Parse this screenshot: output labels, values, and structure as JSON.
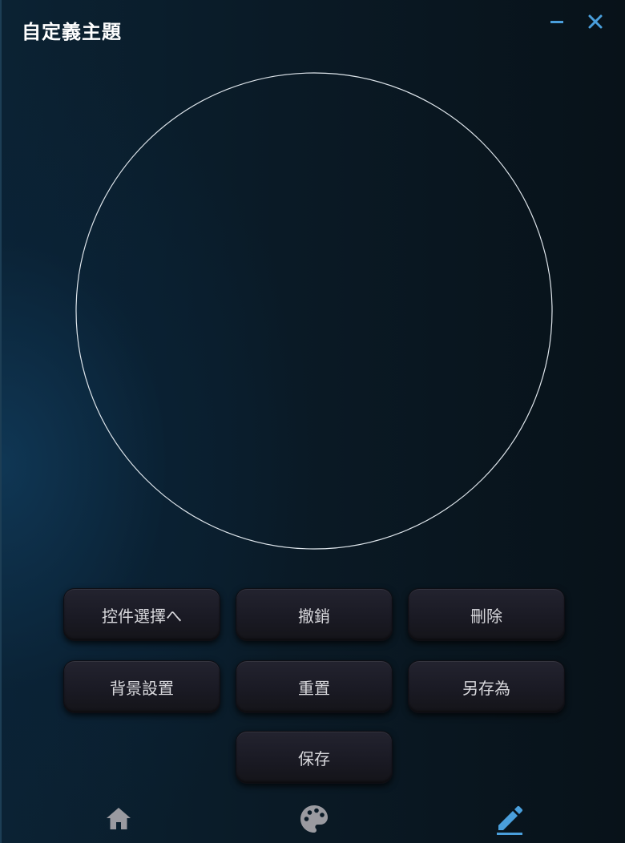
{
  "window": {
    "title": "自定義主題"
  },
  "buttons": {
    "control_select": "控件選擇へ",
    "undo": "撤銷",
    "delete": "刪除",
    "background": "背景設置",
    "reset": "重置",
    "save_as": "另存為",
    "save": "保存"
  },
  "nav": {
    "items": [
      "home-icon",
      "palette-icon",
      "pencil-icon"
    ],
    "active": "pencil-icon"
  },
  "colors": {
    "accent": "#4a9fdc",
    "icon_gray": "#9a9aa0",
    "button_text": "#d8d8dc",
    "circle_stroke": "#dfe6ec"
  }
}
